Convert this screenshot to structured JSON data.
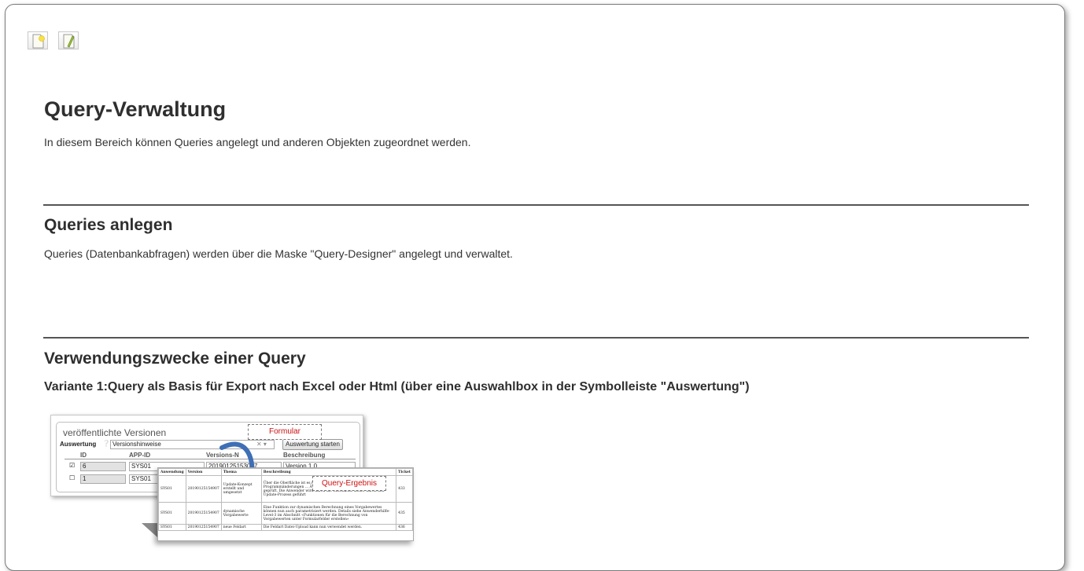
{
  "toolbar": {
    "new_icon": "new-document-icon",
    "edit_icon": "edit-pencil-icon"
  },
  "page": {
    "title": "Query-Verwaltung",
    "intro": "In diesem Bereich können Queries angelegt und anderen Objekten zugeordnet werden."
  },
  "section_create": {
    "heading": "Queries anlegen",
    "text": "Queries (Datenbankabfragen) werden über die Maske \"Query-Designer\" angelegt und verwaltet."
  },
  "section_usage": {
    "heading": "Verwendungszwecke einer Query",
    "variant1": "Variante 1:Query als Basis für Export nach Excel oder Html (über eine Auswahlbox in der Symbolleiste \"Auswertung\")"
  },
  "illustration": {
    "legend": "veröffentlichte Versionen",
    "auswertung_label": "Auswertung",
    "select_value": "Versionshinweise",
    "start_button": "Auswertung starten",
    "callout_form": "Formular",
    "callout_result": "Query-Ergebnis",
    "columns": [
      "ID",
      "APP-ID",
      "Versions-N",
      "Beschreibung"
    ],
    "rows": [
      {
        "id": "6",
        "app": "SYS01",
        "version": "20190125153007",
        "desc": "Version 1.0"
      },
      {
        "id": "1",
        "app": "SYS01",
        "version": "",
        "desc": ""
      }
    ],
    "result_headers": [
      "Anwendung",
      "Version",
      "Thema",
      "Beschreibung",
      "Ticket"
    ],
    "result_rows": [
      {
        "app": "SYS01",
        "version": "20190125154907",
        "thema": "Update-Konzept erstellt und umgesetzt",
        "desc": "Über die Oberfläche ist es möglich ... Dabei werden Programmänderungen ... Änderungen werden nicht übernommen ... geprüft. Die Anwender wird durch die Oberfläche sicher durch den Update-Prozess geführt",
        "ticket": "433"
      },
      {
        "app": "SYS01",
        "version": "20190125154907",
        "thema": "dynamische Vorgabewerte",
        "desc": "Eine Funktion zur dynamischen Berechnung eines Vorgabewertes können nun auch parametrisiert werden. Details siehe Anwenderhilfe-Level-3 im Abschnitt «Funktionen für die Berechnung von Vorgabewerten unter Formularfelder erstellen»",
        "ticket": "435"
      },
      {
        "app": "SYS01",
        "version": "20190125154907",
        "thema": "neue Feldart",
        "desc": "Die Feldart Datei-Upload kann nun verwendet werden.",
        "ticket": "436"
      }
    ]
  }
}
